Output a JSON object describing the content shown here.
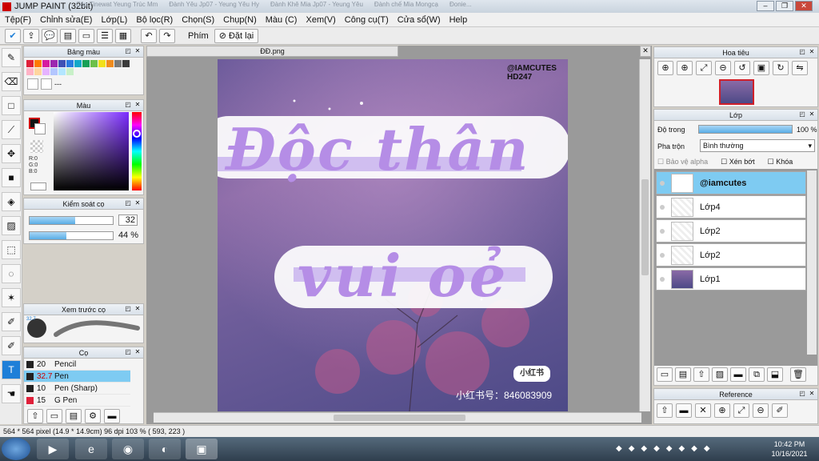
{
  "window": {
    "title": "JUMP PAINT (32bit)",
    "bg_tabs": [
      "Cân Tinewat Yeung Trúc Mm",
      "Đành Yêu Jp07 - Yeung Yêu Hy",
      "Đành Khê Mia Jp07 - Yeung Yêu",
      "Đành chế Mia Mongcạ",
      "Ðonie..."
    ]
  },
  "menu": [
    "Tệp(F)",
    "Chỉnh sửa(E)",
    "Lớp(L)",
    "Bộ lọc(R)",
    "Chọn(S)",
    "Chụp(N)",
    "Màu (C)",
    "Xem(V)",
    "Công cụ(T)",
    "Cửa sổ(W)",
    "Help"
  ],
  "toolbar": {
    "key_label": "Phím",
    "reset_label": "Đặt lại"
  },
  "palette": {
    "title": "Bảng màu",
    "name": "---",
    "colors": [
      "#e0203a",
      "#ff7a00",
      "#d61aa0",
      "#9b27b0",
      "#3f51b5",
      "#2a7be0",
      "#12a8c9",
      "#18a058",
      "#6cc04a",
      "#f2e01b",
      "#f08c1e",
      "#7a7a7a",
      "#3b3b3b",
      "#f4f4f4",
      "#ffb3c6",
      "#ffd59e",
      "#e6b3ff",
      "#b3c6ff",
      "#b3e6ff",
      "#c8f0c8"
    ]
  },
  "color": {
    "title": "Màu",
    "r": "R:0",
    "g": "G:0",
    "b": "B:0"
  },
  "brush_control": {
    "title": "Kiểm soát cọ",
    "size": "32",
    "opacity": "44 %",
    "size_fraction": 0.55,
    "opacity_fraction": 0.44
  },
  "brush_preview": {
    "title": "Xem trước cọ",
    "size_note": "32.7"
  },
  "brushes": {
    "title": "Cọ",
    "items": [
      {
        "size": "20",
        "name": "Pencil",
        "color": "#222222"
      },
      {
        "size": "32.7",
        "name": "Pen",
        "color": "#222222",
        "selected": true
      },
      {
        "size": "10",
        "name": "Pen (Sharp)",
        "color": "#222222"
      },
      {
        "size": "15",
        "name": "G Pen",
        "color": "#e0203a"
      }
    ]
  },
  "document": {
    "tab": "ĐĐ.png"
  },
  "artwork": {
    "watermark": "@IAMCUTES\nHD247",
    "line1": "Độc thân",
    "line2": "vui oẻ",
    "app_badge": "小红书",
    "id_text": "小红书号：846083909"
  },
  "navigator": {
    "title": "Hoa tiêu"
  },
  "layers": {
    "title": "Lớp",
    "opacity_label": "Độ trong",
    "opacity_value": "100 %",
    "opacity_fraction": 1.0,
    "blend_label": "Pha trộn",
    "blend_value": "Bình thường",
    "protect_alpha": "Bảo vệ alpha",
    "clipping": "Xén bớt",
    "lock": "Khóa",
    "items": [
      {
        "name": "@iamcutes",
        "selected": true
      },
      {
        "name": "Lớp4"
      },
      {
        "name": "Lớp2"
      },
      {
        "name": "Lớp2"
      },
      {
        "name": "Lớp1"
      }
    ]
  },
  "reference": {
    "title": "Reference"
  },
  "status": {
    "text": "564 * 564 pixel  (14.9 * 14.9cm)  96 dpi  103 %  ( 593, 223 )"
  },
  "taskbar": {
    "time": "10:42 PM",
    "date": "10/16/2021"
  }
}
